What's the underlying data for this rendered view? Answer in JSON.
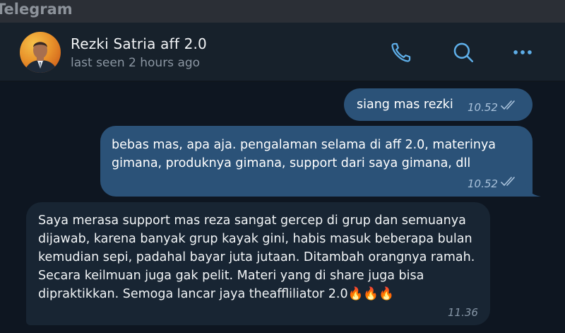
{
  "app": {
    "title": "Telegram"
  },
  "header": {
    "contact_name": "Rezki Satria aff 2.0",
    "status": "last seen 2 hours ago",
    "icons": [
      "phone-icon",
      "search-icon",
      "more-icon"
    ]
  },
  "messages": [
    {
      "direction": "out",
      "text": "siang mas rezki",
      "time": "10.52",
      "status": "read"
    },
    {
      "direction": "out",
      "text": "bebas mas, apa aja. pengalaman selama di aff 2.0, materinya gimana, produknya gimana, support dari saya gimana, dll",
      "time": "10.52",
      "status": "read"
    },
    {
      "direction": "in",
      "text": "Saya merasa support mas reza sangat gercep di grup dan semuanya dijawab, karena banyak grup kayak gini, habis masuk beberapa bulan kemudian sepi, padahal bayar juta jutaan. Ditambah orangnya ramah. Secara keilmuan juga gak pelit. Materi yang di share juga bisa dipraktikkan. Semoga lancar jaya theaffliliator 2.0🔥🔥🔥",
      "time": "11.36"
    }
  ],
  "colors": {
    "outgoing_bubble": "#2b5278",
    "incoming_bubble": "#182533",
    "header_bg": "#17212b",
    "chat_bg": "#0e1621",
    "accent": "#5eaee8"
  }
}
